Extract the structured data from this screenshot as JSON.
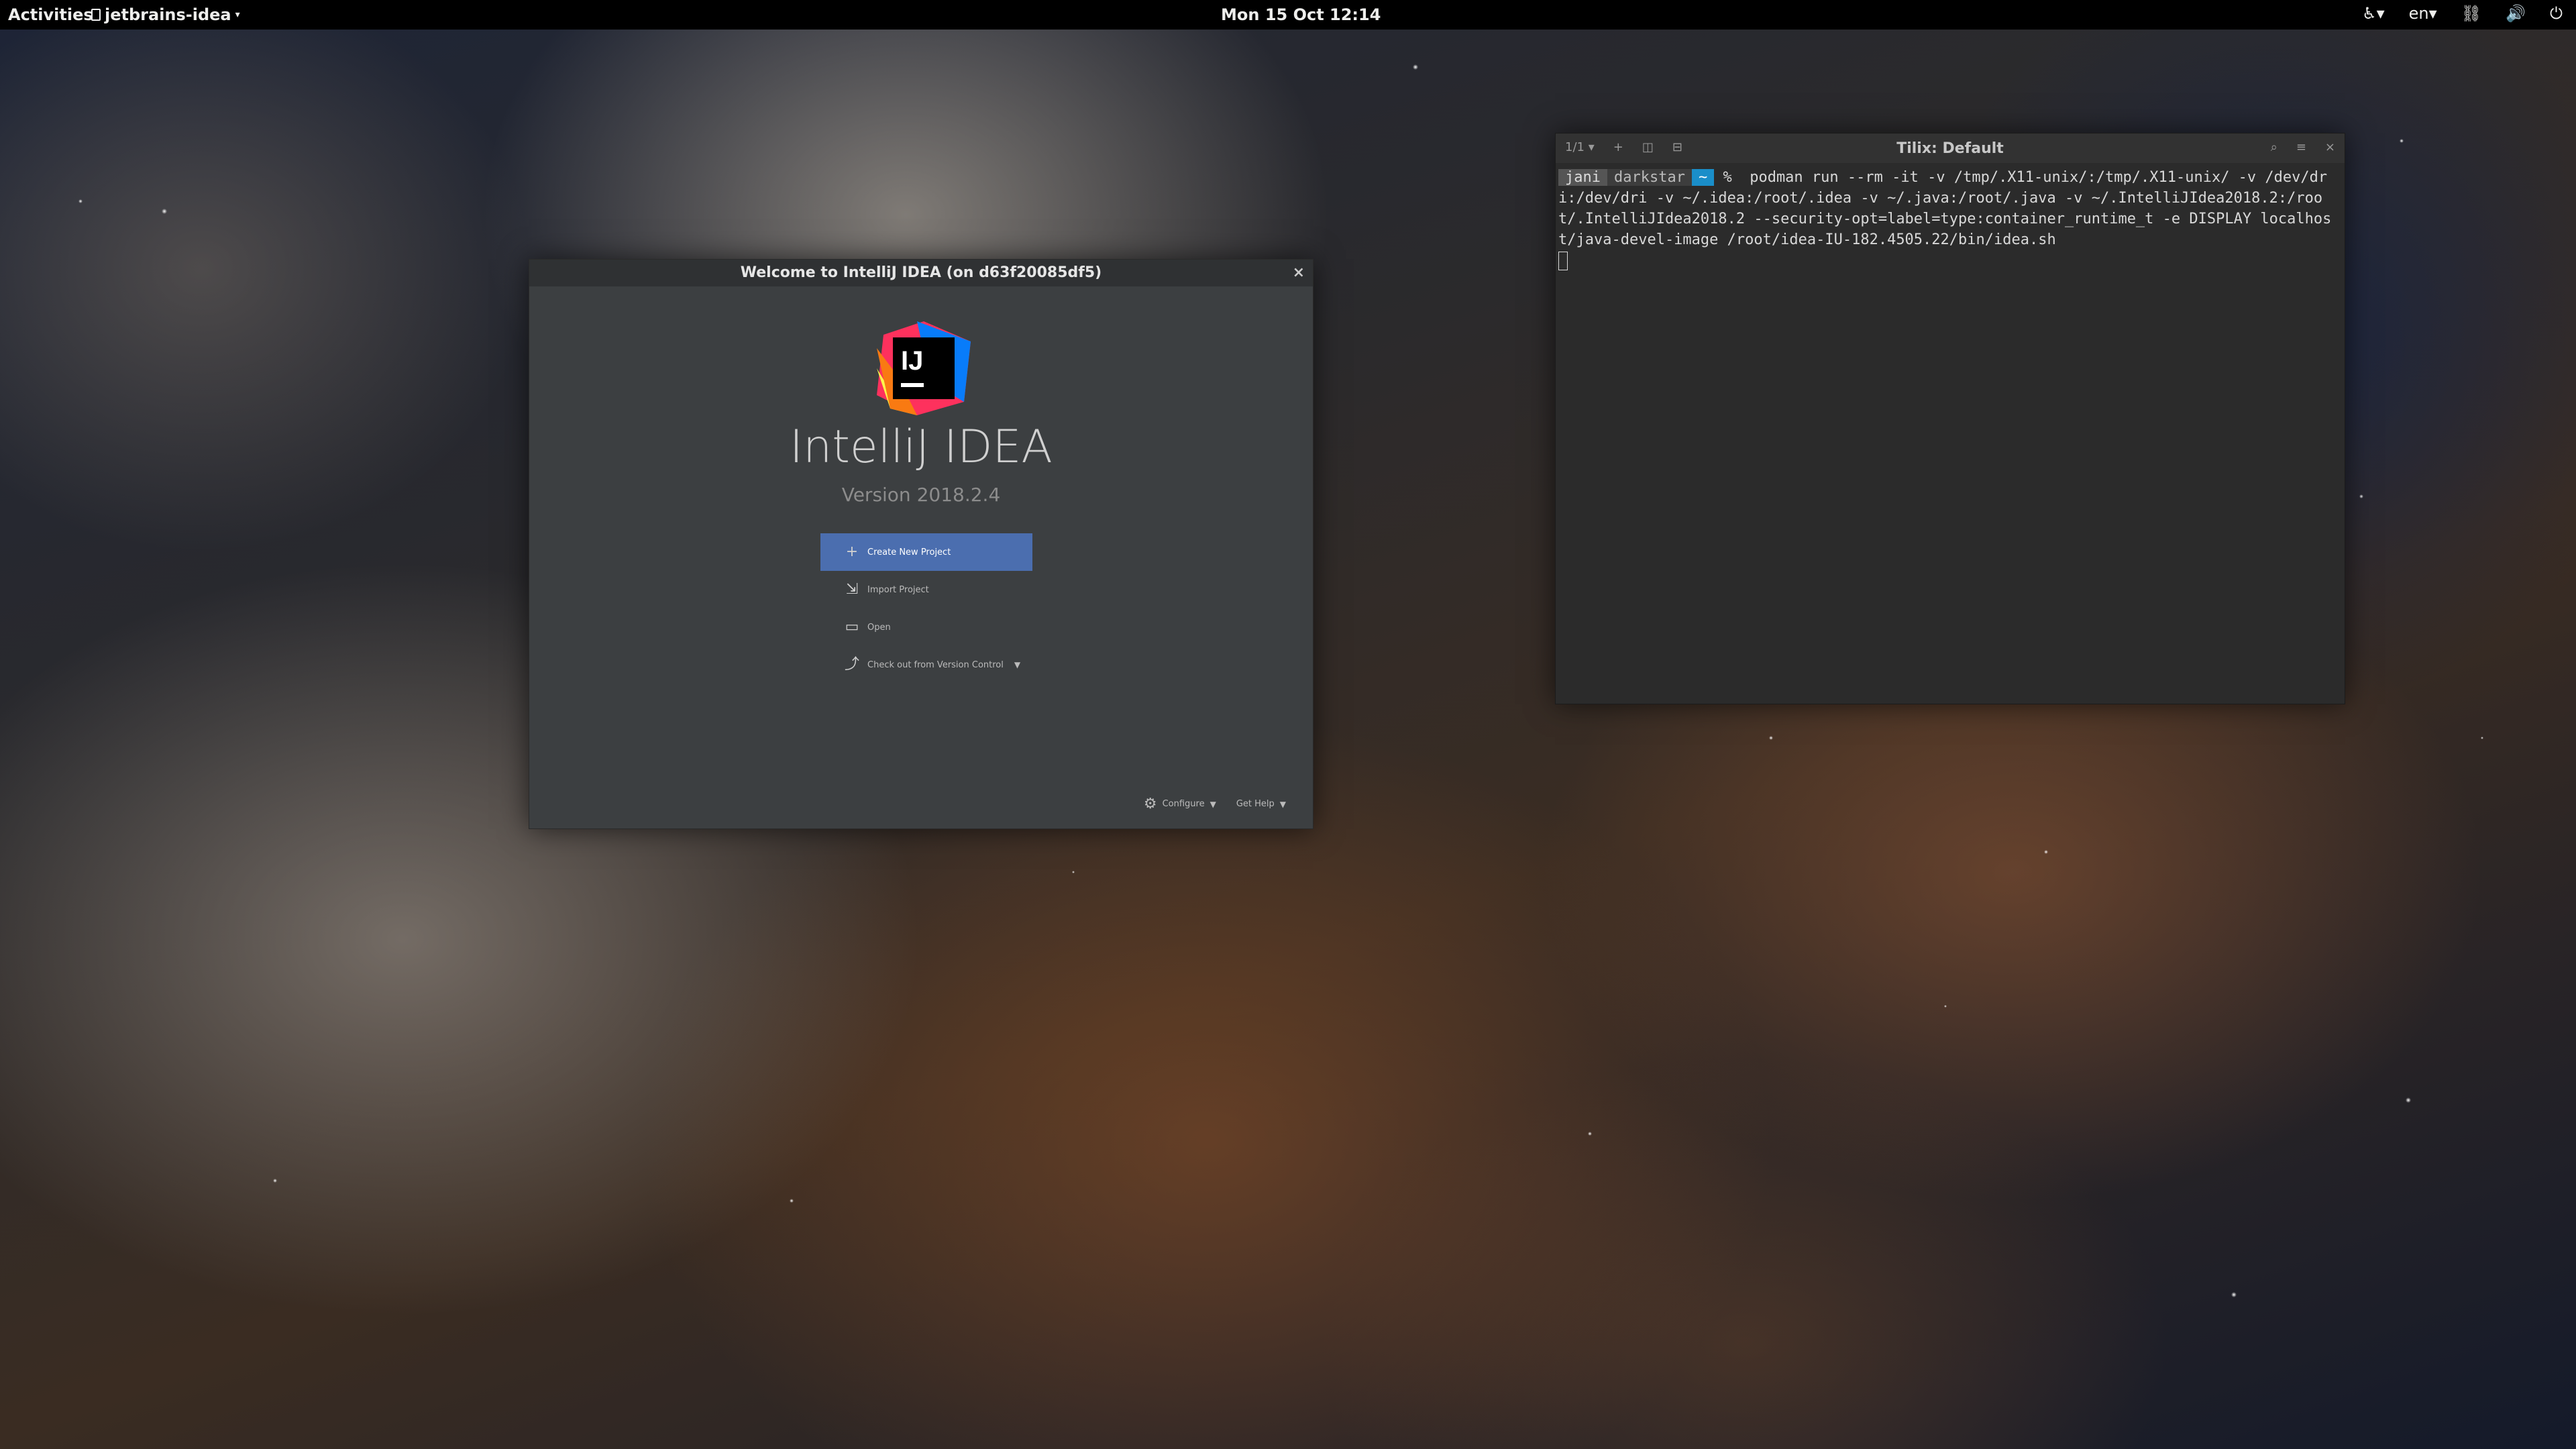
{
  "topbar": {
    "activities": "Activities",
    "app_menu": "jetbrains-idea",
    "clock": "Mon 15 Oct  12:14",
    "language": "en"
  },
  "intellij": {
    "window_title": "Welcome to IntelliJ IDEA (on d63f20085df5)",
    "product_name": "IntelliJ IDEA",
    "version": "Version 2018.2.4",
    "actions": [
      {
        "label": "Create New Project",
        "icon": "plus-icon"
      },
      {
        "label": "Import Project",
        "icon": "import-icon"
      },
      {
        "label": "Open",
        "icon": "folder-icon"
      },
      {
        "label": "Check out from Version Control",
        "icon": "vcs-icon"
      }
    ],
    "footer": {
      "configure": "Configure",
      "get_help": "Get Help"
    },
    "accent_color": "#4b6eaf"
  },
  "tilix": {
    "title": "Tilix: Default",
    "session_count": "1/1",
    "prompt_user": "jani",
    "prompt_host": "darkstar",
    "prompt_dir": "~",
    "prompt_symbol": "%",
    "command": "podman run --rm -it -v /tmp/.X11-unix/:/tmp/.X11-unix/ -v /dev/dri:/dev/dri -v ~/.idea:/root/.idea -v ~/.java:/root/.java -v ~/.IntelliJIdea2018.2:/root/.IntelliJIdea2018.2 --security-opt=label=type:container_runtime_t -e DISPLAY localhost/java-devel-image /root/idea-IU-182.4505.22/bin/idea.sh",
    "prompt_dir_color": "#1a8ec9"
  }
}
